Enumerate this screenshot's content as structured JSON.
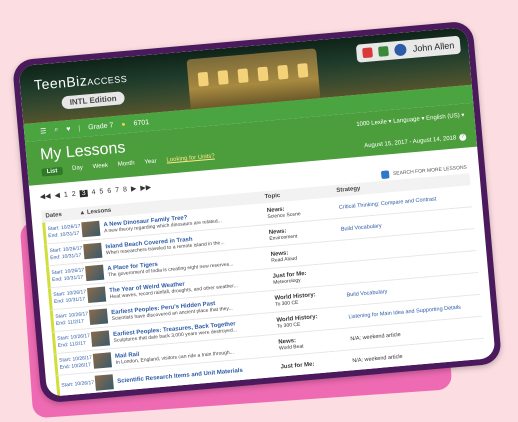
{
  "app": {
    "logo_text": "TeenBiz",
    "logo_suffix": "ACCESS",
    "edition": "INTL Edition",
    "user": "John Allen"
  },
  "toolbar": {
    "grade": "Grade 7",
    "points": "6701"
  },
  "page": {
    "title": "My Lessons",
    "view_tabs": [
      "List",
      "Day",
      "Week",
      "Month",
      "Year"
    ],
    "help_link": "Looking for Units?",
    "prefs": "1000 Lexile ▾   Language ▾   English (US) ▾",
    "date_range": "August 15, 2017 - August 14, 2018",
    "search_more": "SEARCH FOR MORE LESSONS"
  },
  "pager": {
    "pages": [
      "1",
      "2",
      "3",
      "4",
      "5",
      "6",
      "7",
      "8"
    ],
    "current": "3"
  },
  "table": {
    "headers": [
      "Dates",
      "Lessons",
      "Topic",
      "Strategy"
    ],
    "rows": [
      {
        "start": "Start: 10/26/17",
        "end": "End: 10/31/17",
        "title": "A New Dinosaur Family Tree?",
        "desc": "A new theory regarding which dinosaurs are related...",
        "topic": "News:",
        "topic_sub": "Science Scene",
        "strategy": "Critical Thinking: Compare and Contrast",
        "strategy_link": true
      },
      {
        "start": "Start: 10/26/17",
        "end": "End: 10/31/17",
        "title": "Island Beach Covered in Trash",
        "desc": "When researchers traveled to a remote island in the...",
        "topic": "News:",
        "topic_sub": "Environment",
        "strategy": "Build Vocabulary",
        "strategy_link": true
      },
      {
        "start": "Start: 10/26/17",
        "end": "End: 10/31/17",
        "title": "A Place for Tigers",
        "desc": "The government of India is creating eight new reserves...",
        "topic": "News:",
        "topic_sub": "Read Aloud",
        "strategy": "",
        "strategy_link": true
      },
      {
        "start": "Start: 10/26/17",
        "end": "End: 10/31/17",
        "title": "The Year of Weird Weather",
        "desc": "Heat waves, record rainfall, droughts, and other weather...",
        "topic": "Just for Me:",
        "topic_sub": "Meteorology",
        "strategy": "",
        "strategy_link": true
      },
      {
        "start": "Start: 10/26/17",
        "end": "End: 11/2/17",
        "title": "Earliest Peoples: Peru's Hidden Past",
        "desc": "Scientists have discovered an ancient place that they...",
        "topic": "World History:",
        "topic_sub": "To 300 CE",
        "strategy": "Build Vocabulary",
        "strategy_link": true
      },
      {
        "start": "Start: 10/26/17",
        "end": "End: 11/2/17",
        "title": "Earliest Peoples: Treasures, Back Together",
        "desc": "Sculptures that date back 3,000 years were destroyed...",
        "topic": "World History:",
        "topic_sub": "To 300 CE",
        "strategy": "Listening for Main Idea and Supporting Details",
        "strategy_link": true
      },
      {
        "start": "Start: 10/26/17",
        "end": "End: 10/26/17",
        "title": "Mail Rail",
        "desc": "In London, England, visitors can ride a train through...",
        "topic": "News:",
        "topic_sub": "World Beat",
        "strategy": "N/A: weekend article",
        "strategy_link": false
      },
      {
        "start": "Start: 10/26/17",
        "end": "",
        "title": "Scientific Research Items and Unit Materials",
        "desc": "",
        "topic": "Just for Me:",
        "topic_sub": "",
        "strategy": "N/A: weekend article",
        "strategy_link": false
      }
    ]
  },
  "colors": {
    "frame": "#4a1a5c",
    "accent_green": "#4c9e3c",
    "row_marker": "#d1de3b",
    "link_blue": "#2d5ba6",
    "background": "#fcdde1",
    "back_card": "#ee6ab2"
  }
}
